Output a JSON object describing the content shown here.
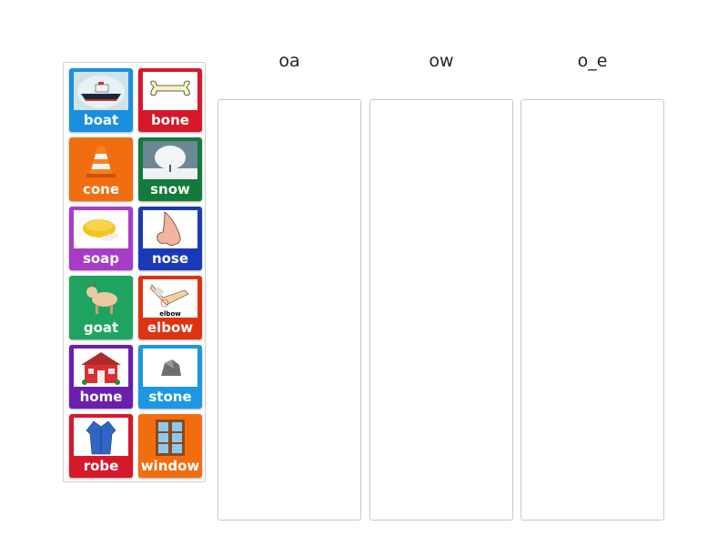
{
  "activity": {
    "type": "group sort",
    "groups": [
      {
        "heading": "oa"
      },
      {
        "heading": "ow"
      },
      {
        "heading": "o_e"
      }
    ],
    "cards": [
      {
        "label": "boat",
        "icon": "boat-icon",
        "color": "#1a8fe0"
      },
      {
        "label": "bone",
        "icon": "bone-icon",
        "color": "#d7182a"
      },
      {
        "label": "cone",
        "icon": "traffic-cone-icon",
        "color": "#f26d0f"
      },
      {
        "label": "snow",
        "icon": "snowy-tree-icon",
        "color": "#127a3a"
      },
      {
        "label": "soap",
        "icon": "soap-icon",
        "color": "#a93bc9"
      },
      {
        "label": "nose",
        "icon": "nose-icon",
        "color": "#1a3ab5"
      },
      {
        "label": "goat",
        "icon": "goat-icon",
        "color": "#1ea45e"
      },
      {
        "label": "elbow",
        "icon": "elbow-icon",
        "color": "#dd3311"
      },
      {
        "label": "home",
        "icon": "house-icon",
        "color": "#6a1fb0"
      },
      {
        "label": "stone",
        "icon": "stone-icon",
        "color": "#1c97e3"
      },
      {
        "label": "robe",
        "icon": "robe-icon",
        "color": "#d7182a"
      },
      {
        "label": "window",
        "icon": "window-icon",
        "color": "#f26d0f"
      }
    ],
    "elbow_caption": "elbow"
  }
}
